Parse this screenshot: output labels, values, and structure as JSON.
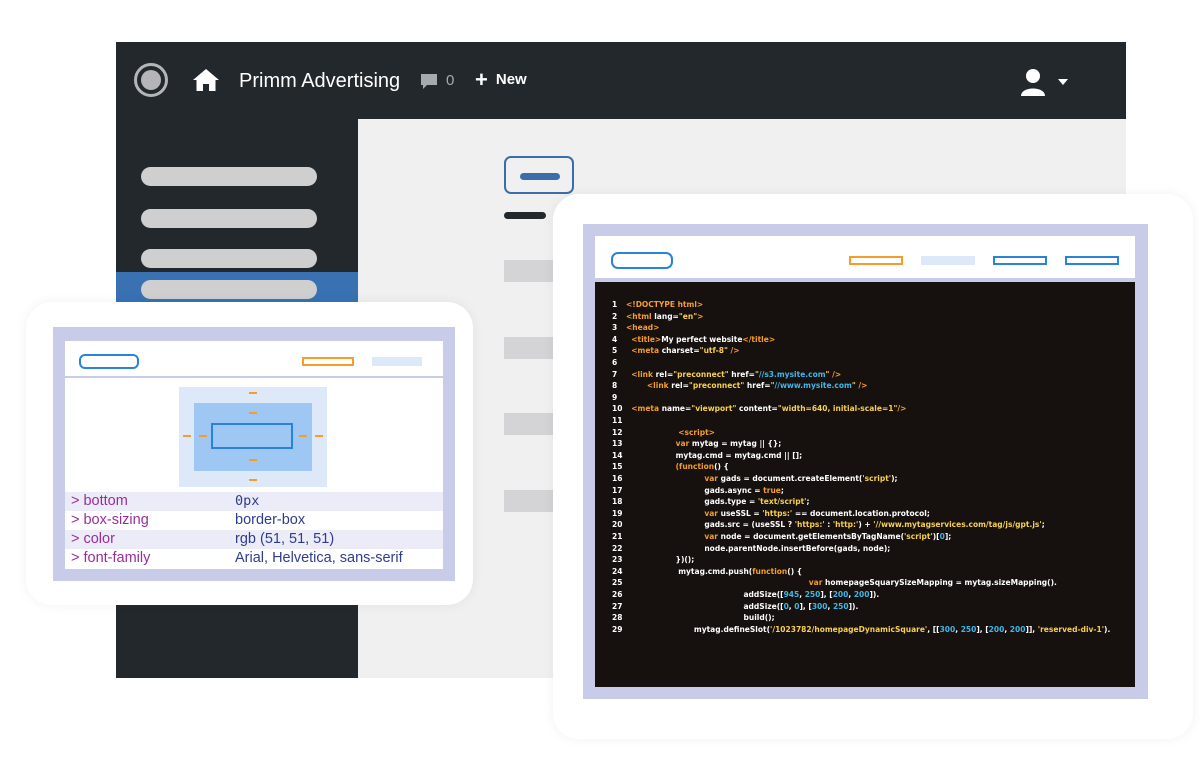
{
  "topbar": {
    "site_name": "Primm Advertising",
    "comment_count": "0",
    "new_label": "New"
  },
  "inspector": {
    "properties": [
      {
        "name": "> bottom",
        "value": "0px"
      },
      {
        "name": "> box-sizing",
        "value": "border-box"
      },
      {
        "name": "> color",
        "value": "rgb (51, 51, 51)"
      },
      {
        "name": "> font-family",
        "value": "Arial, Helvetica, sans-serif"
      }
    ]
  },
  "code": {
    "lines": [
      {
        "n": "1",
        "html": "<span class=\"o\">&lt;!DOCTYPE html&gt;</span>"
      },
      {
        "n": "2",
        "html": "<span class=\"o\">&lt;html</span> lang=<span class=\"y\">\"en\"</span><span class=\"o\">&gt;</span>"
      },
      {
        "n": "3",
        "html": "<span class=\"o\">&lt;head&gt;</span>"
      },
      {
        "n": "4",
        "html": "  <span class=\"o\">&lt;title&gt;</span>My perfect website<span class=\"o\">&lt;/title&gt;</span>"
      },
      {
        "n": "5",
        "html": "  <span class=\"o\">&lt;meta</span> charset=<span class=\"y\">\"utf-8\"</span> <span class=\"o\">/&gt;</span>"
      },
      {
        "n": "6",
        "html": ""
      },
      {
        "n": "7",
        "html": "  <span class=\"o\">&lt;link</span> rel=<span class=\"y\">\"preconnect\"</span> href=<span class=\"y\">\"</span><span class=\"c\">//s3.mysite.com</span><span class=\"y\">\"</span> <span class=\"o\">/&gt;</span>"
      },
      {
        "n": "8",
        "html": "        <span class=\"o\">&lt;link</span> rel=<span class=\"y\">\"preconnect\"</span> href=<span class=\"y\">\"</span><span class=\"c\">//www.mysite.com</span><span class=\"y\">\"</span> <span class=\"o\">/&gt;</span>"
      },
      {
        "n": "9",
        "html": ""
      },
      {
        "n": "10",
        "html": "  <span class=\"o\">&lt;meta</span> name=<span class=\"y\">\"viewport\"</span> content=<span class=\"y\">\"width=640, initial-scale=1\"</span><span class=\"o\">/&gt;</span>"
      },
      {
        "n": "11",
        "html": ""
      },
      {
        "n": "12",
        "html": "                    <span class=\"o\">&lt;script&gt;</span>"
      },
      {
        "n": "13",
        "html": "                   <span class=\"o\">var</span> mytag = mytag || {};"
      },
      {
        "n": "14",
        "html": "                   mytag.cmd = mytag.cmd || [];"
      },
      {
        "n": "15",
        "html": "                   <span class=\"o\">(function</span>() {"
      },
      {
        "n": "16",
        "html": "                              <span class=\"o\">var</span> gads = document.createElement(<span class=\"y\">'script'</span>);"
      },
      {
        "n": "17",
        "html": "                              gads.async = <span class=\"o\">true</span>;"
      },
      {
        "n": "18",
        "html": "                              gads.type = <span class=\"y\">'text/script'</span>;"
      },
      {
        "n": "19",
        "html": "                              <span class=\"o\">var</span> useSSL = <span class=\"y\">'https:'</span> == document.location.protocol;"
      },
      {
        "n": "20",
        "html": "                              gads.src = (useSSL ? <span class=\"y\">'https:'</span> : <span class=\"y\">'http:'</span>) + <span class=\"y\">'//www.mytagservices.com/tag/js/gpt.js'</span>;"
      },
      {
        "n": "21",
        "html": "                              <span class=\"o\">var</span> node = document.getElementsByTagName(<span class=\"y\">'script'</span>)[<span class=\"c\">0</span>];"
      },
      {
        "n": "22",
        "html": "                              node.parentNode.insertBefore(gads, node);"
      },
      {
        "n": "23",
        "html": "                   })();"
      },
      {
        "n": "24",
        "html": "                    mytag.cmd.push(<span class=\"o\">function</span>() {"
      },
      {
        "n": "25",
        "html": "                                                                      <span class=\"o\">var</span> homepageSquarySizeMapping = mytag.sizeMapping()."
      },
      {
        "n": "26",
        "html": "                                             addSize([<span class=\"c\">945</span>, <span class=\"c\">250</span>], [<span class=\"c\">200</span>, <span class=\"c\">200</span>])."
      },
      {
        "n": "27",
        "html": "                                             addSize([<span class=\"c\">0</span>, <span class=\"c\">0</span>], [<span class=\"c\">300</span>, <span class=\"c\">250</span>])."
      },
      {
        "n": "28",
        "html": "                                             build();"
      },
      {
        "n": "29",
        "html": "                          mytag.defineSlot(<span class=\"y\">'/1023782/homepageDynamicSquare'</span>, [[<span class=\"c\">300</span>, <span class=\"c\">250</span>], [<span class=\"c\">200</span>, <span class=\"c\">200</span>]], <span class=\"y\">'reserved-div-1'</span>)."
      }
    ]
  },
  "colors": {
    "admin_bar": "#23282d",
    "sidebar_active": "#3971b3",
    "accent_orange": "#f59d2a",
    "accent_blue": "#2b82d9",
    "code_bg": "#16110f",
    "property_name": "#9b2d9a",
    "property_value": "#2f3d8f"
  }
}
